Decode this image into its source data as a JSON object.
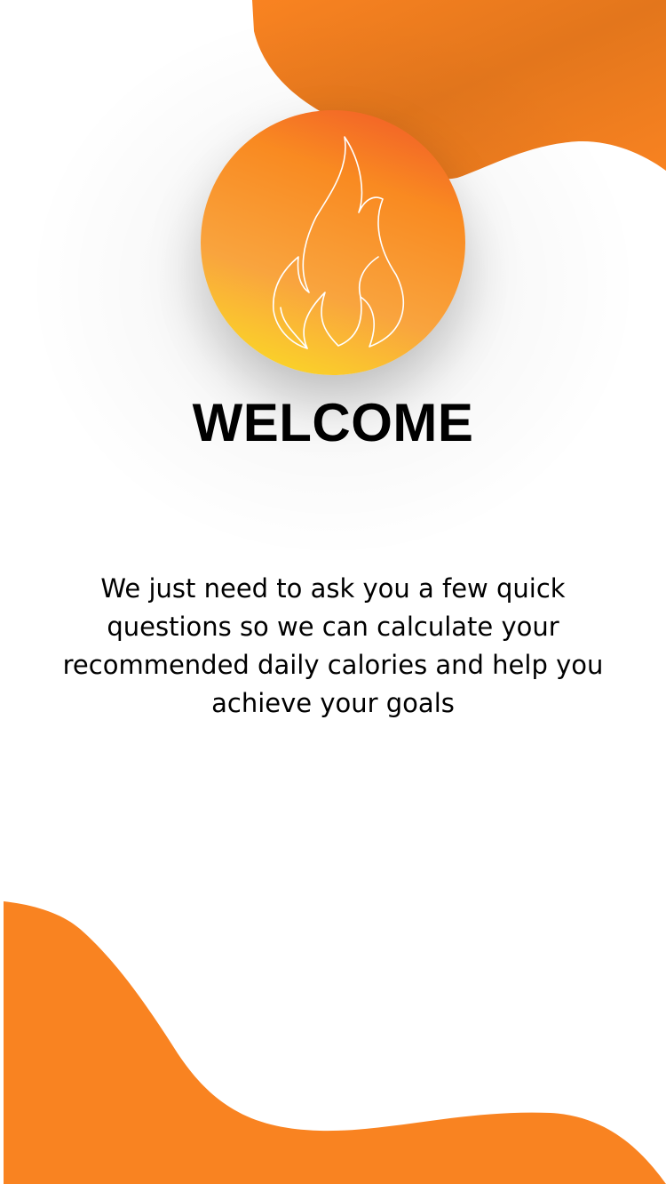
{
  "screen": {
    "title": "WELCOME",
    "message": "We just need to ask you a few quick questions so we can calculate your recommended daily calories and help you achieve your goals"
  },
  "icons": {
    "logo": "flame-icon"
  },
  "colors": {
    "accent_orange": "#f98321",
    "gradient_top": "#f0552a",
    "gradient_bottom": "#fbe321",
    "text": "#000000",
    "background": "#ffffff"
  }
}
